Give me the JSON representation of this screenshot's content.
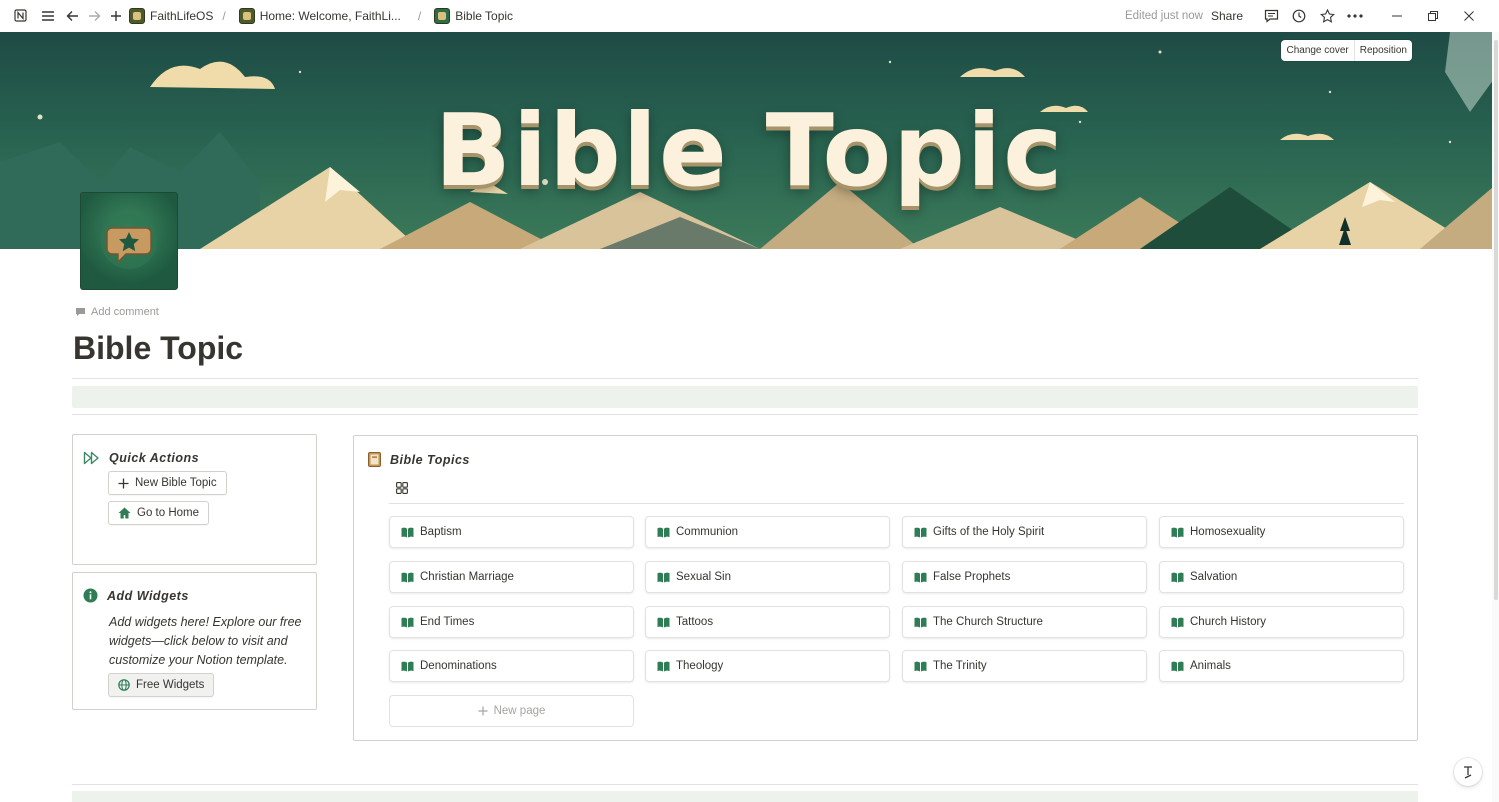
{
  "topbar": {
    "breadcrumbs": [
      {
        "label": "FaithLifeOS"
      },
      {
        "label": "Home: Welcome, FaithLi..."
      },
      {
        "label": "Bible Topic"
      }
    ],
    "separator": "/",
    "edited": "Edited just now",
    "share": "Share"
  },
  "cover": {
    "title": "Bible Topic",
    "change_cover": "Change cover",
    "reposition": "Reposition"
  },
  "page": {
    "add_comment": "Add comment",
    "title": "Bible Topic"
  },
  "quick_actions": {
    "title": "Quick Actions",
    "new_topic": "New Bible Topic",
    "go_home": "Go to Home"
  },
  "add_widgets": {
    "title": "Add Widgets",
    "text": "Add widgets here! Explore our free widgets—click below to visit and customize your Notion template.",
    "button": "Free Widgets"
  },
  "bible_topics": {
    "title": "Bible Topics",
    "items": [
      "Baptism",
      "Communion",
      "Gifts of the Holy Spirit",
      "Homosexuality",
      "Christian Marriage",
      "Sexual Sin",
      "False Prophets",
      "Salvation",
      "End Times",
      "Tattoos",
      "The Church Structure",
      "Church History",
      "Denominations",
      "Theology",
      "The Trinity",
      "Animals"
    ],
    "new_page": "New page"
  },
  "colors": {
    "accent_green": "#2e7d55",
    "callout_bg": "#edf3ec"
  }
}
